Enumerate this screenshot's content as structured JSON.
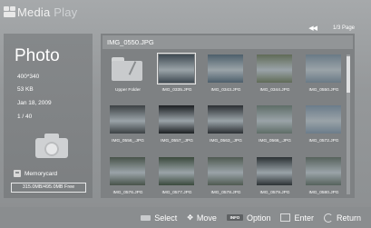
{
  "app": {
    "brand_part1": "Media",
    "brand_part2": " Play"
  },
  "pager": {
    "arrows": "◀◀",
    "page": "1/3 Page",
    "next": "▶▶"
  },
  "left": {
    "title": "Photo",
    "resolution": "400*340",
    "size": "53 KB",
    "date": "Jan 18, 2009",
    "index": "1 / 40",
    "device": "Memorycard",
    "free": "315.0MB/495.0MB Free"
  },
  "main": {
    "filename": "IMG_0550.JPG",
    "tiles": [
      {
        "label": "Upper Folder",
        "type": "folder",
        "bg": "#c9cbcd"
      },
      {
        "label": "IMG_0335.JPG",
        "type": "photo",
        "bg": "#3f4a52",
        "selected": true
      },
      {
        "label": "IMG_0343.JPG",
        "type": "photo",
        "bg": "#4d5f6b"
      },
      {
        "label": "IMG_0344.JPG",
        "type": "photo",
        "bg": "#606b57"
      },
      {
        "label": "IMG_0550.JPG",
        "type": "photo",
        "bg": "#6a7a86"
      },
      {
        "label": "IMG_0556_.JPG",
        "type": "photo",
        "bg": "#3c4144"
      },
      {
        "label": "IMG_0557_.JPG",
        "type": "photo",
        "bg": "#1c1f22"
      },
      {
        "label": "IMG_0563_.JPG",
        "type": "photo",
        "bg": "#2b2f33"
      },
      {
        "label": "IMG_0566_.JPG",
        "type": "photo",
        "bg": "#5e6d67"
      },
      {
        "label": "IMG_0572.JPG",
        "type": "photo",
        "bg": "#6b7c8a"
      },
      {
        "label": "IMG_0576.JPG",
        "type": "photo",
        "bg": "#48534a"
      },
      {
        "label": "IMG_0577.JPG",
        "type": "photo",
        "bg": "#3b4a3d"
      },
      {
        "label": "IMG_0578.JPG",
        "type": "photo",
        "bg": "#4f5a51"
      },
      {
        "label": "IMG_0579.JPG",
        "type": "photo",
        "bg": "#2c3235"
      },
      {
        "label": "IMG_0580.JPG",
        "type": "photo",
        "bg": "#56625c"
      }
    ]
  },
  "footer": {
    "select": "Select",
    "move": "Move",
    "info_icon": "INFO",
    "option": "Option",
    "enter": "Enter",
    "return": "Return"
  },
  "colors": {
    "background": "#8f9294",
    "panel": "#7e8183",
    "highlight": "#e8e8e8"
  }
}
